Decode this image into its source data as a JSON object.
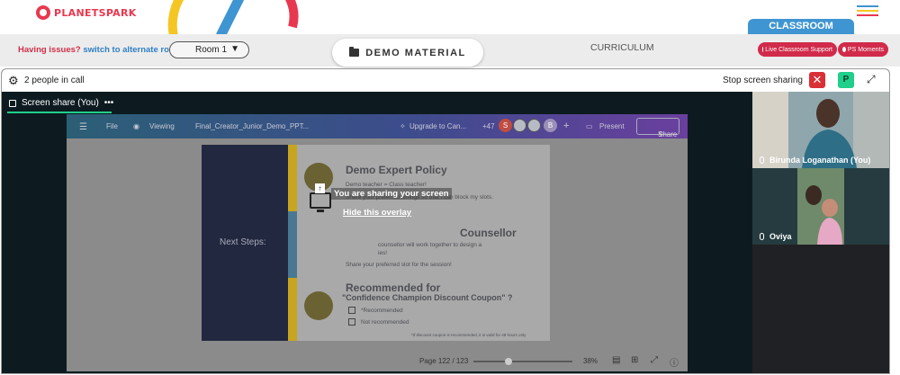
{
  "brand": {
    "logo_text": "PLANETSPARK"
  },
  "header": {
    "classroom_tab": "CLASSROOM",
    "issues_question": "Having issues?",
    "issues_link": "switch to alternate room",
    "room_select": "Room 1",
    "demo_material": "DEMO MATERIAL",
    "curriculum": "CURRICULUM",
    "live_support": "Live Classroom Support",
    "ps_moments": "PS Moments"
  },
  "call": {
    "people_count": "2 people in call",
    "stop_sharing": "Stop screen sharing",
    "participant_initial": "P",
    "share_tab": "Screen share (You)",
    "more": "•••"
  },
  "canva": {
    "file": "File",
    "viewing": "Viewing",
    "doc_title": "Final_Creator_Junior_Demo_PPT...",
    "upgrade": "Upgrade to Can...",
    "plus_count": "+47",
    "avatar_s": "S",
    "avatar_b": "B",
    "present": "Present",
    "share": "Share",
    "page": "Page 122 / 123",
    "zoom": "38%"
  },
  "slide": {
    "next_steps": "Next Steps:",
    "h1": "Demo Expert Policy",
    "t1": "Demo teacher = Class teacher!",
    "t2": "Share your preferred timings so that I can block my slots.",
    "h2": "Counsellor",
    "t3": "counsellor will work together to design a",
    "t4": "ies!",
    "t5": "Share your preferred slot for the session!",
    "h3": "Recommended for",
    "h3b": "\"Confidence Champion Discount Coupon\" ?",
    "opt1": "*Recommended",
    "opt2": "Not recommended",
    "note": "*If discount coupon is recommended, it is valid for 48 hours only"
  },
  "overlay": {
    "title": "You are sharing your screen",
    "hide": "Hide this overlay"
  },
  "participants": [
    {
      "name": "Birunda Loganathan (You)"
    },
    {
      "name": "Oviya"
    }
  ],
  "colors": {
    "brand_red": "#e8384f",
    "classroom_blue": "#3f95d1",
    "stop_red": "#d93036",
    "meet_green": "#1fcf8a"
  }
}
